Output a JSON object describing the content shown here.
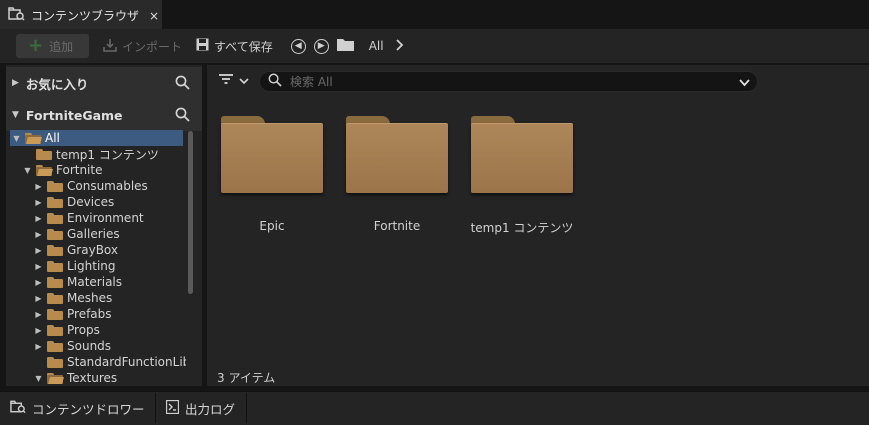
{
  "tab": {
    "title": "コンテンツブラウザ",
    "close": "×"
  },
  "toolbar": {
    "add_label": "追加",
    "import_label": "インポート",
    "save_all_label": "すべて保存",
    "path_label": "All"
  },
  "left_panel": {
    "favorites_label": "お気に入り",
    "project_label": "FortniteGame",
    "tree": [
      {
        "label": "All",
        "indent": 0,
        "expanded": true,
        "selected": true
      },
      {
        "label": "temp1 コンテンツ",
        "indent": 1,
        "expanded": false,
        "selected": false,
        "no_arrow": true
      },
      {
        "label": "Fortnite",
        "indent": 1,
        "expanded": true,
        "selected": false
      },
      {
        "label": "Consumables",
        "indent": 2,
        "expanded": false,
        "selected": false
      },
      {
        "label": "Devices",
        "indent": 2,
        "expanded": false,
        "selected": false
      },
      {
        "label": "Environment",
        "indent": 2,
        "expanded": false,
        "selected": false
      },
      {
        "label": "Galleries",
        "indent": 2,
        "expanded": false,
        "selected": false
      },
      {
        "label": "GrayBox",
        "indent": 2,
        "expanded": false,
        "selected": false
      },
      {
        "label": "Lighting",
        "indent": 2,
        "expanded": false,
        "selected": false
      },
      {
        "label": "Materials",
        "indent": 2,
        "expanded": false,
        "selected": false
      },
      {
        "label": "Meshes",
        "indent": 2,
        "expanded": false,
        "selected": false
      },
      {
        "label": "Prefabs",
        "indent": 2,
        "expanded": false,
        "selected": false
      },
      {
        "label": "Props",
        "indent": 2,
        "expanded": false,
        "selected": false
      },
      {
        "label": "Sounds",
        "indent": 2,
        "expanded": false,
        "selected": false
      },
      {
        "label": "StandardFunctionLib",
        "indent": 2,
        "expanded": false,
        "selected": false,
        "no_arrow": true
      },
      {
        "label": "Textures",
        "indent": 2,
        "expanded": true,
        "selected": false
      }
    ]
  },
  "main": {
    "search_placeholder": "検索 All",
    "folders": [
      {
        "label": "Epic"
      },
      {
        "label": "Fortnite"
      },
      {
        "label": "temp1 コンテンツ"
      }
    ],
    "item_count": "3 アイテム"
  },
  "bottom": {
    "drawer_label": "コンテンツドロワー",
    "log_label": "出力ログ"
  },
  "colors": {
    "selection": "#3d5a80",
    "folder": "#ad865a",
    "panel": "#242424"
  }
}
